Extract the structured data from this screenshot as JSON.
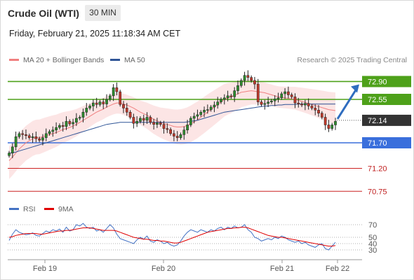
{
  "header": {
    "instrument": "Crude Oil (WTI)",
    "timeframe": "30 MIN",
    "datetime": "Friday, February 21, 2025 11:18:34 AM CET"
  },
  "legend": {
    "ma20_label": "MA 20 + Bollinger Bands",
    "ma50_label": "MA 50",
    "ma20_color": "#f08080",
    "ma50_color": "#2f5597",
    "rsi_label": "RSI",
    "rsi9_label": "9MA",
    "rsi_color": "#4472c4",
    "rsi9_color": "#e00000"
  },
  "credit": "Research © 2025 Trading Central",
  "chart_data": [
    {
      "type": "candlestick",
      "title": "Crude Oil (WTI)",
      "timeframe": "30 MIN",
      "x_ticks": [
        "Feb 19",
        "Feb 20",
        "Feb 21",
        "Feb 22"
      ],
      "ylim": [
        70.4,
        73.4
      ],
      "last_price": 72.14,
      "levels": [
        {
          "value": 72.9,
          "label": "72.90",
          "kind": "resistance",
          "color": "#4ea11a"
        },
        {
          "value": 72.55,
          "label": "72.55",
          "kind": "resistance",
          "color": "#4ea11a"
        },
        {
          "value": 72.14,
          "label": "72.14",
          "kind": "last",
          "color": "#333333"
        },
        {
          "value": 71.7,
          "label": "71.70",
          "kind": "pivot",
          "color": "#3a6fdc"
        },
        {
          "value": 71.2,
          "label": "71.20",
          "kind": "support",
          "color": "#cc2222"
        },
        {
          "value": 70.75,
          "label": "70.75",
          "kind": "support",
          "color": "#cc2222"
        }
      ],
      "arrow": {
        "from": 72.14,
        "to": 72.9,
        "direction": "up",
        "color": "#2f6dbf"
      },
      "close": [
        71.5,
        71.62,
        71.82,
        71.88,
        71.86,
        71.84,
        71.8,
        71.82,
        71.78,
        71.75,
        71.8,
        71.88,
        71.92,
        71.95,
        72.0,
        72.04,
        72.02,
        72.12,
        72.07,
        72.1,
        72.18,
        72.2,
        72.3,
        72.38,
        72.42,
        72.48,
        72.45,
        72.5,
        72.46,
        72.55,
        72.62,
        72.78,
        72.7,
        72.45,
        72.38,
        72.3,
        72.2,
        72.08,
        72.12,
        72.18,
        72.14,
        72.2,
        72.1,
        72.06,
        72.09,
        72.06,
        71.98,
        71.96,
        71.88,
        71.83,
        71.8,
        71.86,
        71.95,
        72.05,
        72.18,
        72.22,
        72.25,
        72.3,
        72.34,
        72.35,
        72.4,
        72.44,
        72.5,
        72.55,
        72.58,
        72.62,
        72.6,
        72.72,
        72.82,
        72.92,
        73.02,
        72.98,
        72.92,
        72.85,
        72.5,
        72.45,
        72.47,
        72.5,
        72.52,
        72.56,
        72.58,
        72.66,
        72.7,
        72.64,
        72.6,
        72.48,
        72.46,
        72.44,
        72.47,
        72.42,
        72.38,
        72.34,
        72.28,
        72.2,
        72.05,
        71.98,
        72.05,
        72.12
      ],
      "ma20": [
        71.35,
        71.42,
        71.5,
        71.58,
        71.64,
        71.7,
        71.74,
        71.78,
        71.8,
        71.8,
        71.82,
        71.84,
        71.86,
        71.88,
        71.9,
        71.93,
        71.96,
        71.98,
        72.0,
        72.03,
        72.06,
        72.1,
        72.14,
        72.18,
        72.22,
        72.26,
        72.3,
        72.33,
        72.36,
        72.4,
        72.43,
        72.46,
        72.48,
        72.48,
        72.46,
        72.44,
        72.41,
        72.38,
        72.34,
        72.3,
        72.27,
        72.24,
        72.2,
        72.16,
        72.13,
        72.1,
        72.08,
        72.06,
        72.04,
        72.02,
        72.01,
        72.01,
        72.02,
        72.04,
        72.07,
        72.11,
        72.15,
        72.2,
        72.25,
        72.3,
        72.35,
        72.4,
        72.45,
        72.5,
        72.55,
        72.58,
        72.6,
        72.63,
        72.66,
        72.69,
        72.7,
        72.71,
        72.72,
        72.71,
        72.7,
        72.69,
        72.68,
        72.66,
        72.64,
        72.62,
        72.6,
        72.59,
        72.58,
        72.57,
        72.56,
        72.55,
        72.53,
        72.51,
        72.49,
        72.47,
        72.45,
        72.43,
        72.41,
        72.39,
        72.37,
        72.35,
        72.34,
        72.33
      ],
      "ma50": [
        71.5,
        71.5,
        71.52,
        71.54,
        71.56,
        71.58,
        71.6,
        71.62,
        71.64,
        71.66,
        71.68,
        71.7,
        71.72,
        71.74,
        71.76,
        71.78,
        71.8,
        71.82,
        71.84,
        71.86,
        71.88,
        71.9,
        71.92,
        71.94,
        71.96,
        71.98,
        72.0,
        72.02,
        72.04,
        72.06,
        72.07,
        72.08,
        72.09,
        72.1,
        72.1,
        72.1,
        72.1,
        72.1,
        72.1,
        72.1,
        72.1,
        72.1,
        72.1,
        72.1,
        72.1,
        72.1,
        72.1,
        72.1,
        72.1,
        72.1,
        72.1,
        72.1,
        72.1,
        72.11,
        72.12,
        72.13,
        72.14,
        72.16,
        72.18,
        72.2,
        72.22,
        72.24,
        72.26,
        72.28,
        72.3,
        72.31,
        72.32,
        72.33,
        72.34,
        72.35,
        72.36,
        72.37,
        72.38,
        72.39,
        72.4,
        72.41,
        72.42,
        72.42,
        72.43,
        72.43,
        72.44,
        72.44,
        72.45,
        72.45,
        72.45,
        72.45,
        72.46,
        72.46,
        72.46,
        72.46,
        72.46,
        72.46,
        72.46,
        72.46,
        72.46,
        72.46,
        72.46,
        72.46
      ]
    },
    {
      "type": "line",
      "title": "RSI",
      "series": [
        {
          "name": "RSI",
          "color": "#4472c4"
        },
        {
          "name": "9MA",
          "color": "#e00000"
        }
      ],
      "ylim": [
        25,
        75
      ],
      "y_ticks": [
        70,
        50,
        40,
        30
      ],
      "rsi": [
        45,
        55,
        62,
        58,
        56,
        54,
        55,
        57,
        53,
        52,
        56,
        60,
        58,
        62,
        60,
        63,
        58,
        66,
        60,
        62,
        70,
        68,
        72,
        66,
        64,
        66,
        60,
        62,
        58,
        64,
        70,
        65,
        55,
        48,
        46,
        44,
        42,
        40,
        46,
        50,
        47,
        52,
        44,
        42,
        46,
        44,
        40,
        42,
        38,
        36,
        38,
        44,
        52,
        58,
        62,
        60,
        58,
        62,
        60,
        58,
        62,
        60,
        64,
        66,
        62,
        66,
        64,
        68,
        65,
        66,
        70,
        62,
        58,
        50,
        48,
        44,
        46,
        48,
        46,
        50,
        48,
        52,
        50,
        46,
        44,
        42,
        44,
        40,
        42,
        38,
        36,
        34,
        38,
        40,
        32,
        30,
        36,
        42
      ],
      "rsi9": [
        50,
        51,
        53,
        54,
        55,
        56,
        56,
        56,
        56,
        55,
        55,
        56,
        57,
        58,
        59,
        60,
        60,
        61,
        61,
        62,
        63,
        64,
        65,
        65,
        65,
        64,
        63,
        62,
        61,
        61,
        61,
        61,
        60,
        58,
        56,
        54,
        52,
        50,
        49,
        48,
        47,
        47,
        46,
        45,
        45,
        44,
        44,
        43,
        42,
        41,
        41,
        42,
        44,
        46,
        48,
        50,
        52,
        54,
        56,
        58,
        59,
        60,
        61,
        62,
        63,
        64,
        64,
        65,
        65,
        66,
        66,
        65,
        63,
        61,
        59,
        57,
        55,
        53,
        52,
        51,
        50,
        50,
        49,
        48,
        47,
        46,
        45,
        44,
        43,
        42,
        41,
        40,
        39,
        38,
        37,
        36,
        36,
        37
      ]
    }
  ]
}
